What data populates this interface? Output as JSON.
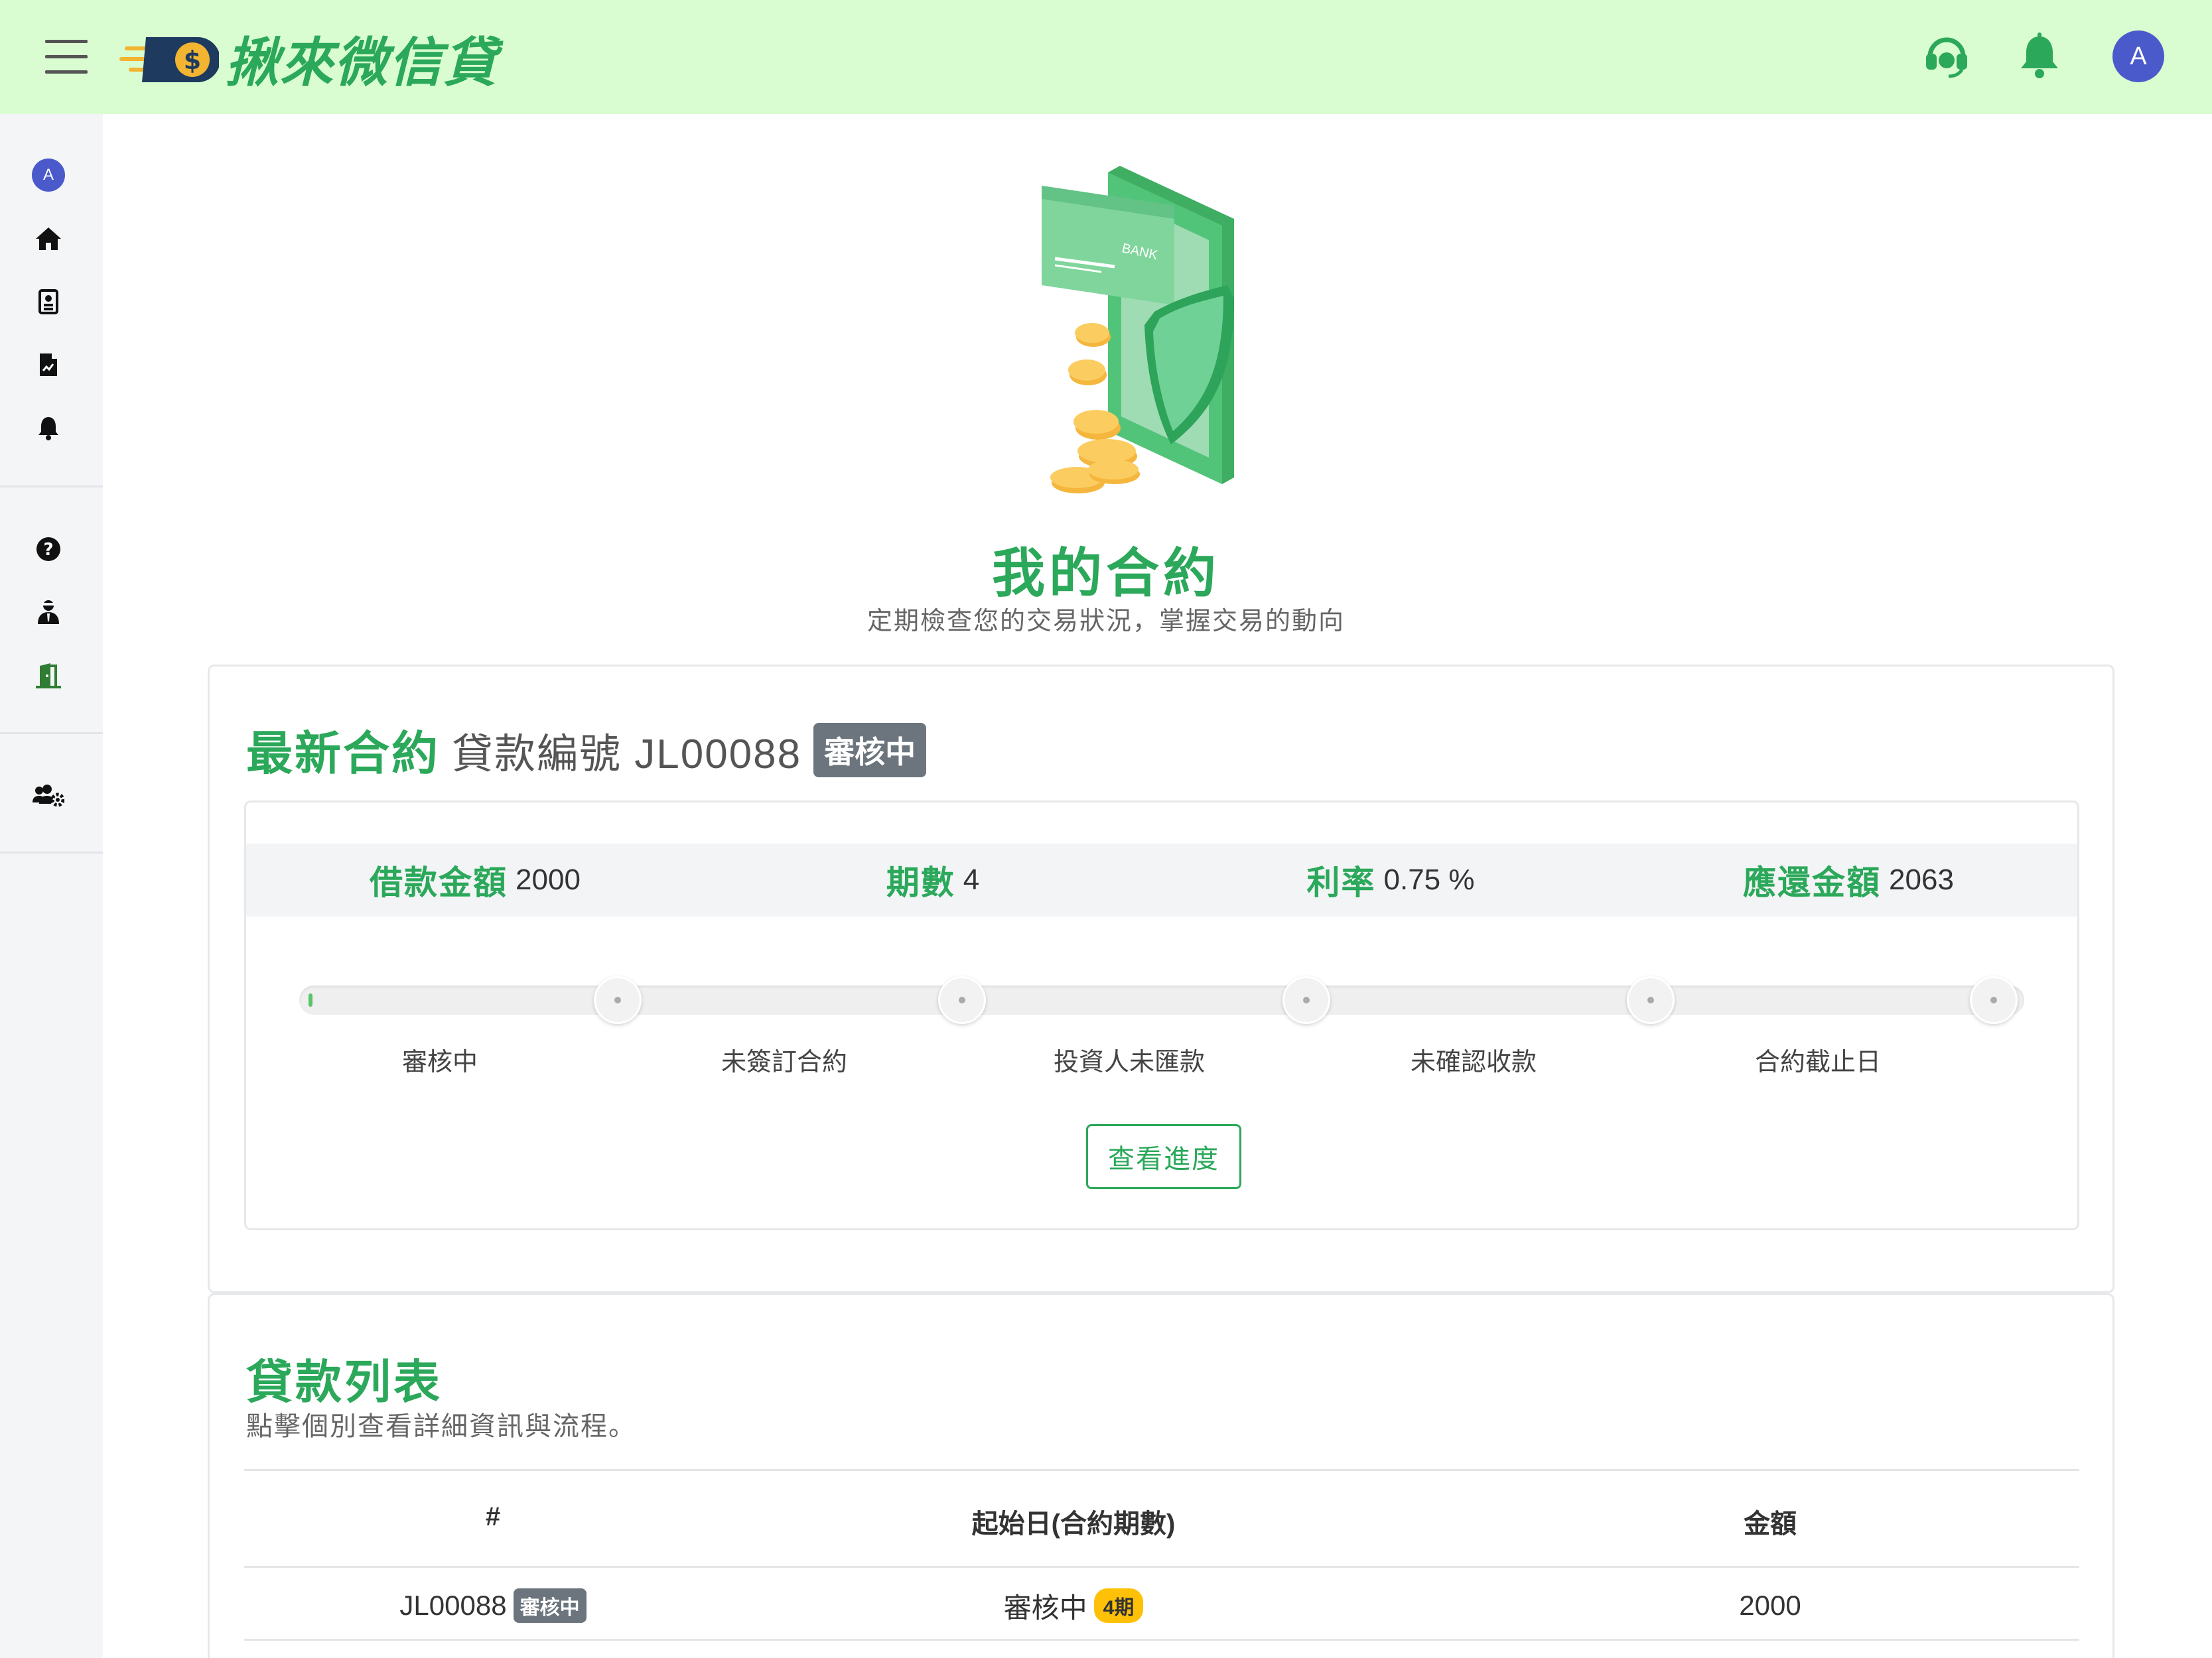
{
  "header": {
    "logo_text": "揪來微信貸",
    "avatar_letter": "A"
  },
  "sidebar": {
    "avatar_letter": "A",
    "items": [
      {
        "icon": "home-icon"
      },
      {
        "icon": "id-card-icon"
      },
      {
        "icon": "file-icon"
      },
      {
        "icon": "bell-icon"
      },
      {
        "icon": "question-icon"
      },
      {
        "icon": "user-tie-icon"
      },
      {
        "icon": "door-exit-icon"
      },
      {
        "icon": "users-cog-icon"
      }
    ]
  },
  "hero": {
    "title": "我的合約",
    "subtitle": "定期檢查您的交易狀況，掌握交易的動向",
    "card_text": "BANK"
  },
  "latest_contract": {
    "title": "最新合約",
    "loan_no_label": "貸款編號 JL00088",
    "status_badge": "審核中",
    "stats": [
      {
        "label": "借款金額",
        "value": "2000"
      },
      {
        "label": "期數",
        "value": "4"
      },
      {
        "label": "利率",
        "value": "0.75 %"
      },
      {
        "label": "應還金額",
        "value": "2063"
      }
    ],
    "progress_fraction": 0.0,
    "steps": [
      "審核中",
      "未簽訂合約",
      "投資人未匯款",
      "未確認收款",
      "合約截止日"
    ],
    "view_progress_button": "查看進度"
  },
  "loan_list": {
    "title": "貸款列表",
    "subtitle": "點擊個別查看詳細資訊與流程。",
    "columns": [
      "#",
      "起始日(合約期數)",
      "金額"
    ],
    "rows": [
      {
        "id": "JL00088",
        "id_badge": "審核中",
        "start": "審核中",
        "period_badge": "4期",
        "amount": "2000"
      }
    ]
  },
  "colors": {
    "brand_green": "#2ba85a",
    "topbar_bg": "#d9fdd0",
    "avatar_blue": "#4a5acb",
    "badge_gray": "#6c757d",
    "badge_yellow": "#ffc107"
  }
}
